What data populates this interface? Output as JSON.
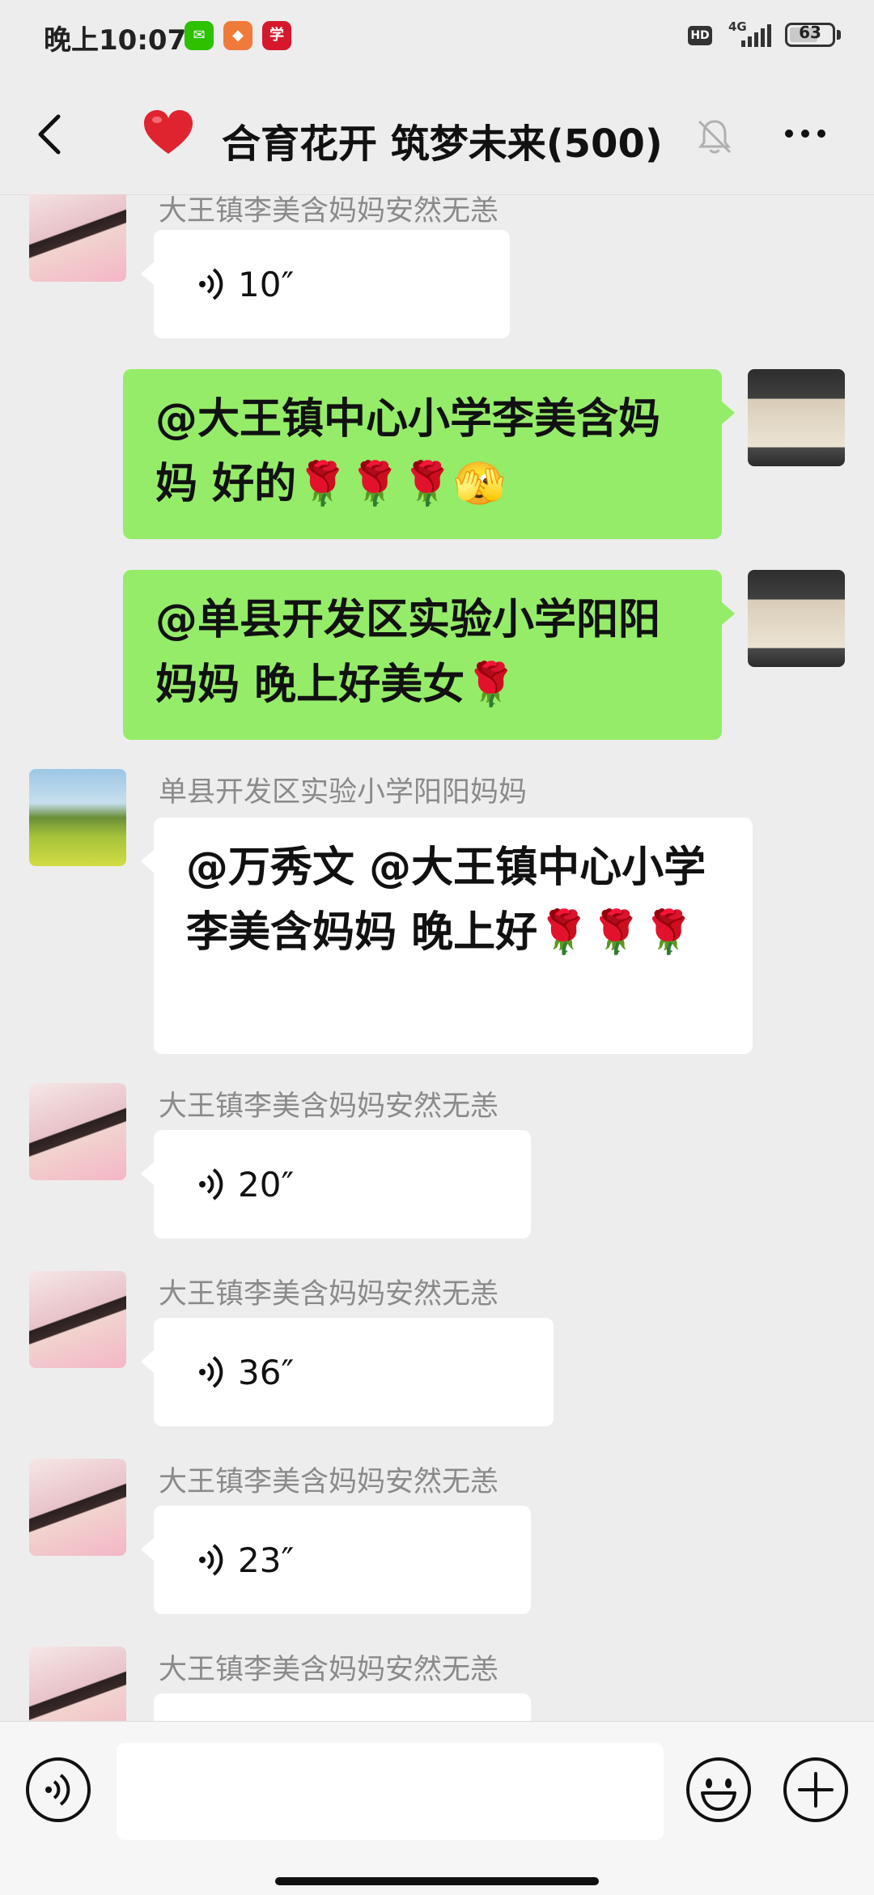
{
  "status_bar": {
    "time": "晚上10:07",
    "hd": "HD",
    "network": "4G",
    "battery": "63"
  },
  "nav": {
    "title": "合育花开 筑梦未来(500)"
  },
  "messages": [
    {
      "sender": "大王镇李美含妈妈安然无恙",
      "duration": "10″"
    },
    {
      "text": "@大王镇中心小学李美含妈妈  好的🌹🌹🌹🫣"
    },
    {
      "text": "@单县开发区实验小学阳阳妈妈  晚上好美女🌹"
    },
    {
      "sender": "单县开发区实验小学阳阳妈妈",
      "text": "@万秀文  @大王镇中心小学李美含妈妈  晚上好🌹🌹🌹"
    },
    {
      "sender": "大王镇李美含妈妈安然无恙",
      "duration": "20″"
    },
    {
      "sender": "大王镇李美含妈妈安然无恙",
      "duration": "36″"
    },
    {
      "sender": "大王镇李美含妈妈安然无恙",
      "duration": "23″"
    },
    {
      "sender": "大王镇李美含妈妈安然无恙"
    }
  ],
  "input": {
    "placeholder": ""
  },
  "colors": {
    "bubble_green": "#95ec69",
    "background": "#ededed",
    "heart": "#e0242f"
  }
}
